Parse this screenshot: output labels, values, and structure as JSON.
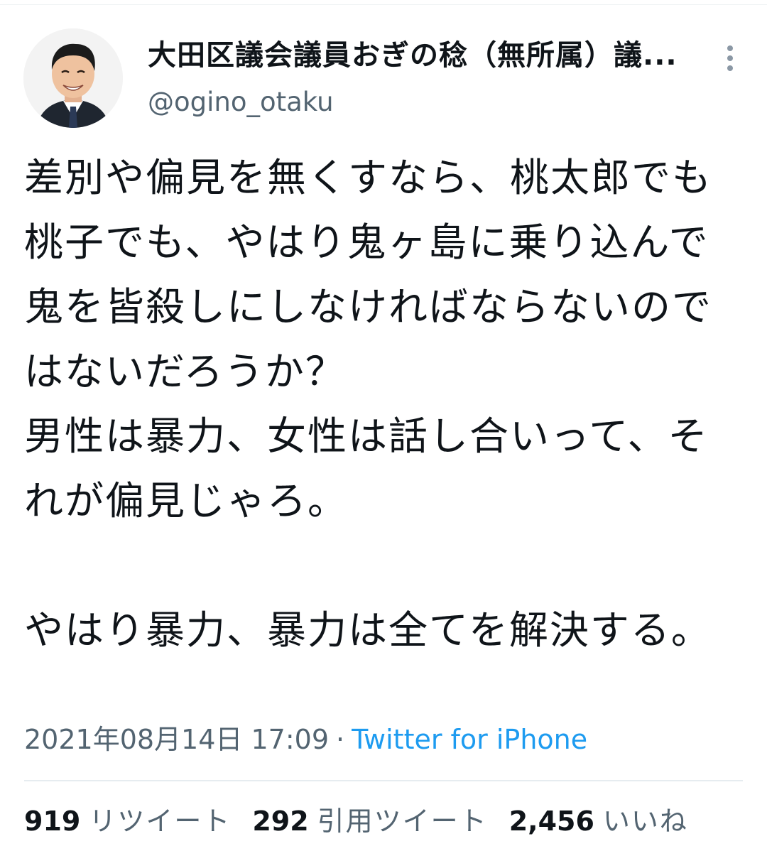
{
  "author": {
    "display_name": "大田区議会議員おぎの稔（無所属）議...",
    "handle": "@ogino_otaku",
    "avatar_icon": "profile-photo"
  },
  "tweet": {
    "text": "差別や偏見を無くすなら、桃太郎でも桃子でも、やはり鬼ヶ島に乗り込んで鬼を皆殺しにしなければならないのではないだろうか？\n男性は暴力、女性は話し合いって、それが偏見じゃろ。\n\nやはり暴力、暴力は全てを解決する。"
  },
  "meta": {
    "timestamp": "2021年08月14日 17:09",
    "separator": "·",
    "source": "Twitter for iPhone"
  },
  "stats": {
    "retweets_count": "919",
    "retweets_label": "リツイート",
    "quotes_count": "292",
    "quotes_label": "引用ツイート",
    "likes_count": "2,456",
    "likes_label": "いいね"
  },
  "colors": {
    "text": "#0f1419",
    "secondary": "#536471",
    "link": "#1d9bf0",
    "divider": "#e6ecf0"
  },
  "icons": {
    "more": "more-vertical-icon"
  }
}
